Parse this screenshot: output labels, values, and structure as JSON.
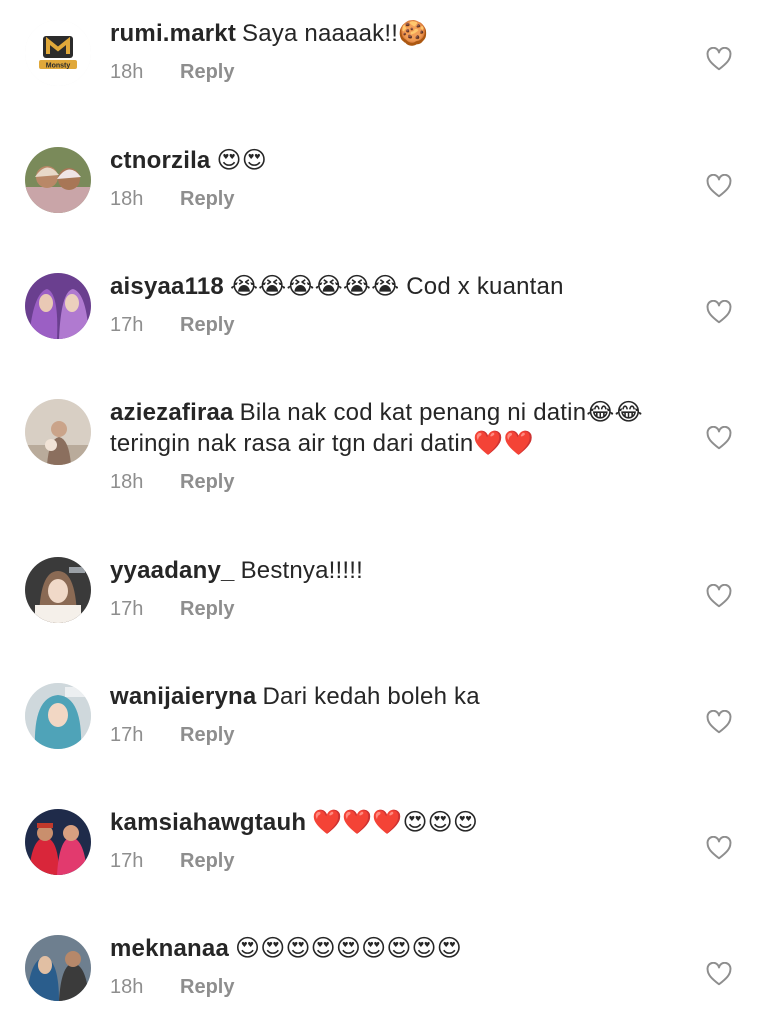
{
  "comments": [
    {
      "username": "rumi.markt",
      "text": "Saya naaaak!!🍪",
      "time": "18h",
      "reply": "Reply"
    },
    {
      "username": "ctnorzila",
      "text": "😍😍",
      "time": "18h",
      "reply": "Reply"
    },
    {
      "username": "aisyaa118",
      "text": "😭😭😭😭😭😭 Cod x kuantan",
      "time": "17h",
      "reply": "Reply"
    },
    {
      "username": "aziezafiraa",
      "text": "Bila nak cod kat penang ni datin😂😂teringin nak rasa air tgn dari datin❤️❤️",
      "time": "18h",
      "reply": "Reply"
    },
    {
      "username": "yyaadany_",
      "text": "Bestnya!!!!!",
      "time": "17h",
      "reply": "Reply"
    },
    {
      "username": "wanijaieryna",
      "text": "Dari kedah boleh ka",
      "time": "17h",
      "reply": "Reply"
    },
    {
      "username": "kamsiahawgtauh",
      "text": "❤️❤️❤️😍😍😍",
      "time": "17h",
      "reply": "Reply"
    },
    {
      "username": "meknanaa",
      "text": "😍😍😍😍😍😍😍😍😍",
      "time": "18h",
      "reply": "Reply"
    }
  ],
  "avatar_logo_text": "Monsty",
  "icons": {
    "like": "heart-outline-icon"
  },
  "colors": {
    "text": "#262626",
    "secondary": "#8e8e8e",
    "background": "#ffffff"
  }
}
